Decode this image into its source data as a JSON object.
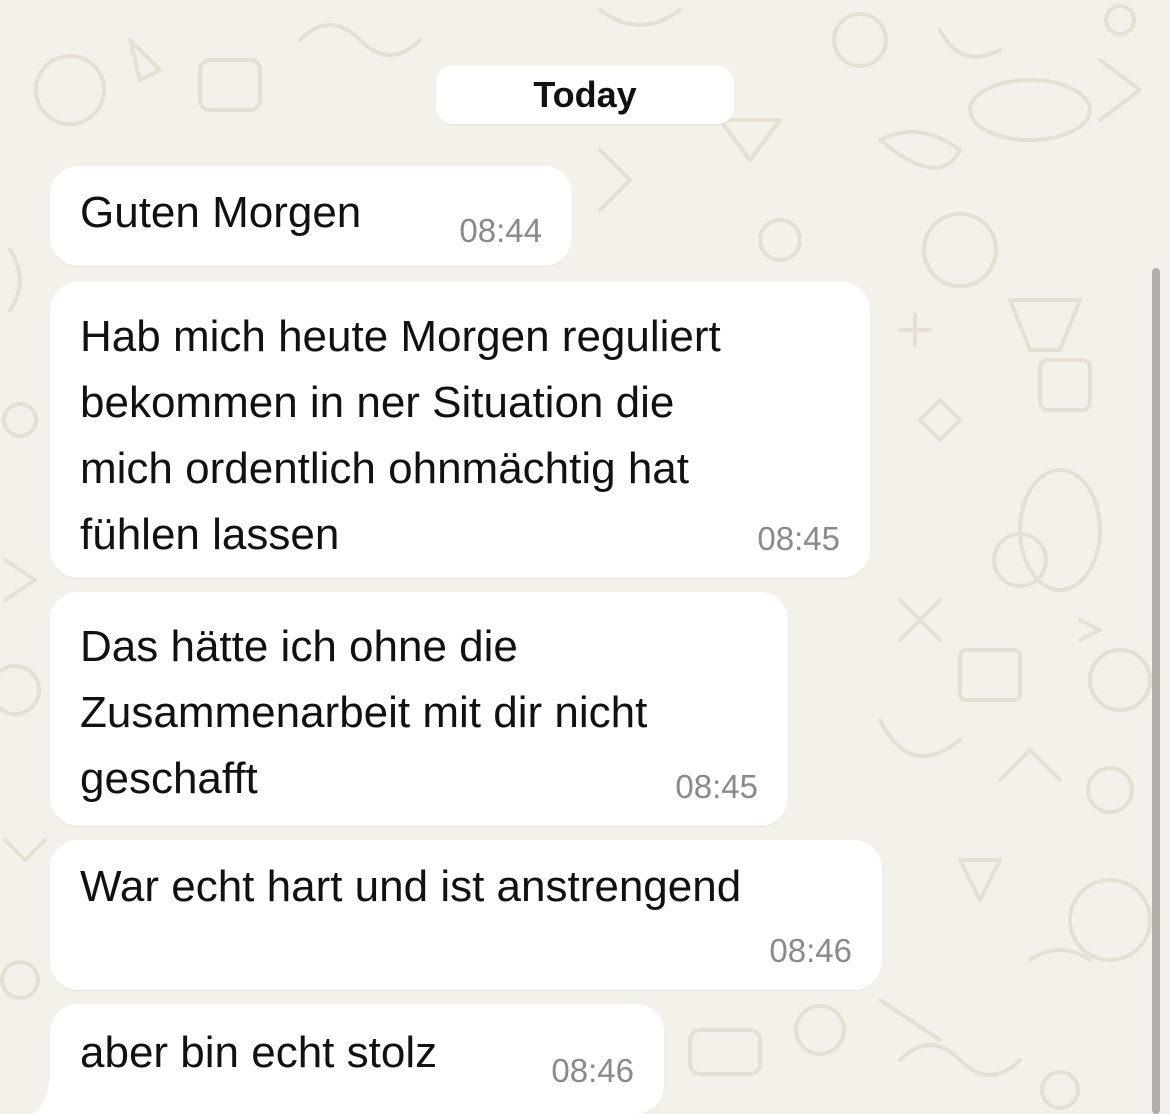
{
  "chat": {
    "date_label": "Today",
    "messages": [
      {
        "text": "Guten Morgen",
        "time": "08:44"
      },
      {
        "text": "Hab mich heute Morgen reguliert\nbekommen in ner Situation die\nmich ordentlich ohnmächtig hat\nfühlen lassen",
        "time": "08:45"
      },
      {
        "text": "Das hätte ich ohne die\nZusammenarbeit mit dir nicht\ngeschafft",
        "time": "08:45"
      },
      {
        "text": "War echt hart und ist anstrengend",
        "time": "08:46"
      },
      {
        "text": "aber bin echt stolz",
        "time": "08:46"
      }
    ]
  },
  "colors": {
    "wallpaper": "#f4f1eb",
    "doodle": "#e6dfd3",
    "bubble": "#ffffff",
    "timestamp": "#8a8a8a"
  },
  "icons": [
    "chat-wallpaper-doodles",
    "bubble-tail-icon"
  ]
}
